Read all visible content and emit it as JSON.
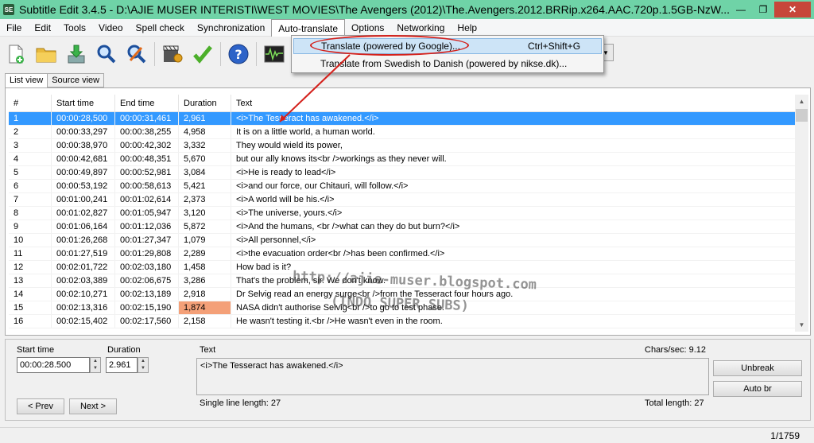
{
  "window": {
    "app_icon_label": "SE",
    "title": "Subtitle Edit 3.4.5 - D:\\AJIE MUSER INTERISTI\\WEST MOVIES\\The Avengers (2012)\\The.Avengers.2012.BRRip.x264.AAC.720p.1.5GB-NzW...",
    "min_glyph": "—",
    "max_glyph": "❐",
    "close_glyph": "✕"
  },
  "menu": [
    "File",
    "Edit",
    "Tools",
    "Video",
    "Spell check",
    "Synchronization",
    "Auto-translate",
    "Options",
    "Networking",
    "Help"
  ],
  "toolbar_icons": [
    "new-file-icon",
    "open-folder-icon",
    "save-download-icon",
    "find-icon",
    "replace-icon",
    "visual-sync-icon",
    "spell-check-icon",
    "help-icon",
    "waveform-icon",
    "video-icon"
  ],
  "dropdown": {
    "items": [
      {
        "label": "Translate (powered by Google)...",
        "shortcut": "Ctrl+Shift+G"
      },
      {
        "label": "Translate from Swedish to Danish (powered by nikse.dk)...",
        "shortcut": ""
      }
    ]
  },
  "tabs": [
    "List view",
    "Source view"
  ],
  "grid": {
    "headers": [
      "#",
      "Start time",
      "End time",
      "Duration",
      "Text"
    ],
    "rows": [
      [
        "1",
        "00:00:28,500",
        "00:00:31,461",
        "2,961",
        "<i>The Tesseract has awakened.</i>"
      ],
      [
        "2",
        "00:00:33,297",
        "00:00:38,255",
        "4,958",
        "It is on a little world, a human world."
      ],
      [
        "3",
        "00:00:38,970",
        "00:00:42,302",
        "3,332",
        "They would wield its power,"
      ],
      [
        "4",
        "00:00:42,681",
        "00:00:48,351",
        "5,670",
        "but our ally knows its<br />workings as they never will."
      ],
      [
        "5",
        "00:00:49,897",
        "00:00:52,981",
        "3,084",
        "<i>He is ready to lead</i>"
      ],
      [
        "6",
        "00:00:53,192",
        "00:00:58,613",
        "5,421",
        "<i>and our force, our Chitauri, will follow.</i>"
      ],
      [
        "7",
        "00:01:00,241",
        "00:01:02,614",
        "2,373",
        "<i>A world will be his.</i>"
      ],
      [
        "8",
        "00:01:02,827",
        "00:01:05,947",
        "3,120",
        "<i>The universe, yours.</i>"
      ],
      [
        "9",
        "00:01:06,164",
        "00:01:12,036",
        "5,872",
        "<i>And the humans, <br />what can they do but burn?</i>"
      ],
      [
        "10",
        "00:01:26,268",
        "00:01:27,347",
        "1,079",
        "<i>All personnel,</i>"
      ],
      [
        "11",
        "00:01:27,519",
        "00:01:29,808",
        "2,289",
        "<i>the evacuation order<br />has been confirmed.</i>"
      ],
      [
        "12",
        "00:02:01,722",
        "00:02:03,180",
        "1,458",
        "How bad is it?"
      ],
      [
        "13",
        "00:02:03,389",
        "00:02:06,675",
        "3,286",
        "That's the problem, sir. We don't know."
      ],
      [
        "14",
        "00:02:10,271",
        "00:02:13,189",
        "2,918",
        "Dr Selvig read an energy surge<br />from the Tesseract four hours ago."
      ],
      [
        "15",
        "00:02:13,316",
        "00:02:15,190",
        "1,874",
        "NASA didn't authorise Selvig<br />to go to test phase."
      ],
      [
        "16",
        "00:02:15,402",
        "00:02:17,560",
        "2,158",
        "He wasn't testing it.<br />He wasn't even in the room."
      ]
    ],
    "selected_row": 0,
    "highlight_duration_row": 14,
    "highlight_color": "#f4a078",
    "selection_color": "#3399ff"
  },
  "watermark": {
    "line1": "http://ajie-muser.blogspot.com",
    "line2": "(INDO SUPER SUBS)"
  },
  "edit": {
    "start_time_label": "Start time",
    "start_time_value": "00:00:28.500",
    "duration_label": "Duration",
    "duration_value": "2.961",
    "text_label": "Text",
    "chars_sec": "Chars/sec: 9.12",
    "text_value": "<i>The Tesseract has awakened.</i>",
    "single_line_length": "Single line length: 27",
    "total_length": "Total length: 27",
    "unbreak": "Unbreak",
    "auto_br": "Auto br",
    "prev": "< Prev",
    "next": "Next >"
  },
  "status": {
    "position": "1/1759"
  }
}
